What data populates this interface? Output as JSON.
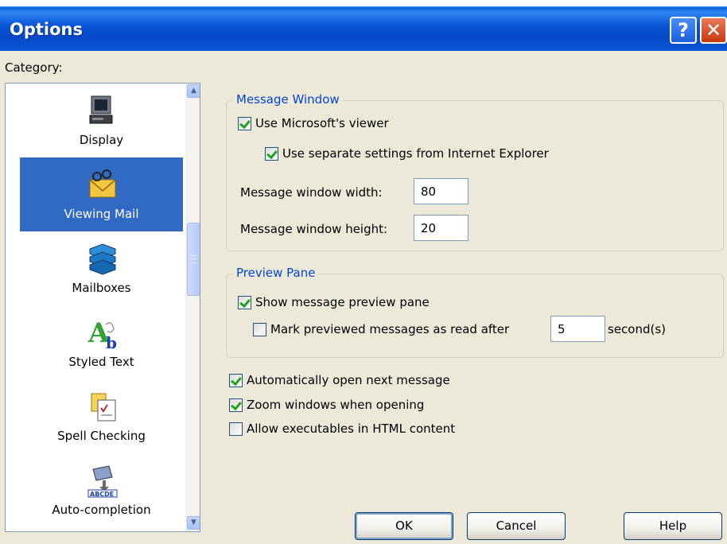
{
  "window": {
    "title": "Options"
  },
  "category": {
    "label": "Category:",
    "items": [
      {
        "label": "Display",
        "icon": "computer-icon"
      },
      {
        "label": "Viewing Mail",
        "icon": "envelope-glasses-icon",
        "selected": true
      },
      {
        "label": "Mailboxes",
        "icon": "mailboxes-icon"
      },
      {
        "label": "Styled Text",
        "icon": "styled-text-icon"
      },
      {
        "label": "Spell Checking",
        "icon": "spell-check-icon"
      },
      {
        "label": "Auto-completion",
        "icon": "auto-completion-icon"
      }
    ]
  },
  "message_window": {
    "title": "Message Window",
    "use_viewer": {
      "label": "Use Microsoft's viewer",
      "checked": true
    },
    "separate_settings": {
      "label": "Use separate settings from Internet Explorer",
      "checked": true
    },
    "width": {
      "label": "Message window width:",
      "value": "80"
    },
    "height": {
      "label": "Message window height:",
      "value": "20"
    }
  },
  "preview_pane": {
    "title": "Preview Pane",
    "show_pane": {
      "label": "Show message preview pane",
      "checked": true
    },
    "mark_read": {
      "label": "Mark previewed messages as read after",
      "checked": false,
      "value": "5",
      "unit": "second(s)"
    }
  },
  "options": {
    "auto_open": {
      "label": "Automatically open next message",
      "checked": true
    },
    "zoom": {
      "label": "Zoom windows when opening",
      "checked": true
    },
    "executables": {
      "label": "Allow executables in HTML content",
      "checked": false
    }
  },
  "buttons": {
    "ok": "OK",
    "cancel": "Cancel",
    "help": "Help"
  },
  "colors": {
    "selection": "#316ac5",
    "group_title": "#0046d5",
    "titlebar": "#0a56d6"
  }
}
